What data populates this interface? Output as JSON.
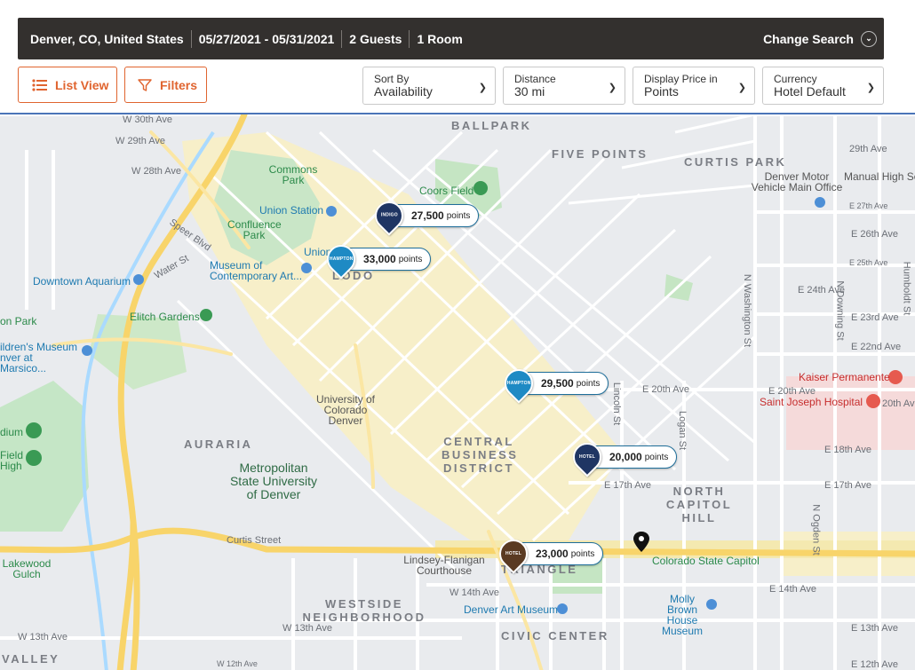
{
  "search": {
    "location": "Denver, CO, United States",
    "dates": "05/27/2021 - 05/31/2021",
    "guests": "2 Guests",
    "rooms": "1 Room",
    "change_label": "Change Search"
  },
  "controls": {
    "list_view_label": "List View",
    "filters_label": "Filters",
    "sort": {
      "label": "Sort By",
      "value": "Availability"
    },
    "distance": {
      "label": "Distance",
      "value": "30 mi"
    },
    "price": {
      "label": "Display Price in",
      "value": "Points"
    },
    "currency": {
      "label": "Currency",
      "value": "Hotel Default"
    }
  },
  "colors": {
    "accent": "#e0642f",
    "bar": "#33302e",
    "marker_border": "#1e6e9a"
  },
  "map": {
    "districts": {
      "ballpark": "BALLPARK",
      "five_points": "FIVE POINTS",
      "curtis_park": "CURTIS PARK",
      "lodo": "LODO",
      "auraria": "AURARIA",
      "cbd": "CENTRAL BUSINESS DISTRICT",
      "north_capitol_hill": "NORTH CAPITOL HILL",
      "triangle": "TRIANGLE",
      "westside": "WESTSIDE NEIGHBORHOOD",
      "civic_center": "CIVIC CENTER",
      "valley": "VALLEY"
    },
    "pois": {
      "commons_park": "Commons Park",
      "coors_field": "Coors Field",
      "union_station": "Union Station",
      "confluence_park": "Confluence Park",
      "union": "Union",
      "museum_contemporary": "Museum of Contemporary Art...",
      "downtown_aquarium": "Downtown Aquarium",
      "elitch_gardens": "Elitch Gardens",
      "childrens_museum": "ildren's Museum nver at Marsico...",
      "ucd": "University of Colorado Denver",
      "msu": "Metropolitan State University of Denver",
      "denver_motor": "Denver Motor Vehicle Main Office",
      "manual_high": "Manual High Sc",
      "kaiser": "Kaiser Permanente",
      "saint_joseph": "Saint Joseph Hospital",
      "capitol": "Colorado State Capitol",
      "molly_brown": "Molly Brown House Museum",
      "art_museum": "Denver Art Museum",
      "lindsey": "Lindsey-Flanigan Courthouse",
      "lakewood_gulch": "Lakewood Gulch",
      "dium": "dium",
      "field_high": "Field High",
      "on_park": "on Park"
    },
    "streets": {
      "w30": "W 30th Ave",
      "w29": "W 29th Ave",
      "w28": "W 28th Ave",
      "e29": "29th Ave",
      "e27": "E 27th Ave",
      "e26": "E 26th Ave",
      "e25": "E 25th Ave",
      "e24": "E 24th Ave",
      "e23": "E 23rd Ave",
      "e22": "E 22nd Ave",
      "e20a": "E 20th Ave",
      "e20b": "E 20th Ave",
      "e20c": "20th Ave",
      "e18": "E 18th Ave",
      "e17a": "E 17th Ave",
      "e17b": "E 17th Ave",
      "e14": "E 14th Ave",
      "e13": "E 13th Ave",
      "e12": "E 12th Ave",
      "w14": "W 14th Ave",
      "w13a": "W 13th Ave",
      "w13b": "W 13th Ave",
      "w12": "W 12th Ave",
      "curtis": "Curtis Street",
      "speer": "Speer Blvd",
      "water": "Water St",
      "lincoln": "Lincoln St",
      "logan": "Logan St",
      "washington": "N Washington St",
      "humboldt": "Humboldt St",
      "downing": "N Downing St",
      "ogden": "N Ogden St"
    },
    "hotels": [
      {
        "points": "27,500",
        "unit": "points",
        "brand": "INDIGO",
        "color": "#1f3563"
      },
      {
        "points": "33,000",
        "unit": "points",
        "brand": "HAMPTON",
        "color": "#1e8ac4"
      },
      {
        "points": "29,500",
        "unit": "points",
        "brand": "HAMPTON",
        "color": "#1e8ac4"
      },
      {
        "points": "20,000",
        "unit": "points",
        "brand": "HOTEL",
        "color": "#1f3563"
      },
      {
        "points": "23,000",
        "unit": "points",
        "brand": "HOTEL",
        "color": "#5a3a22"
      }
    ]
  }
}
